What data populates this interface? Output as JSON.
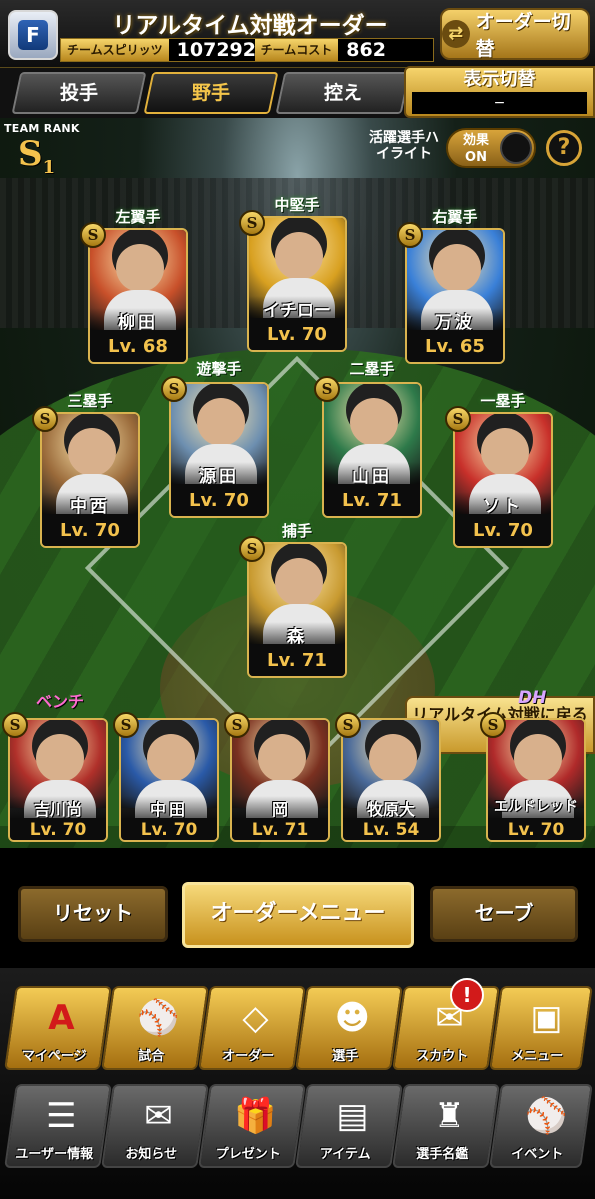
{
  "header": {
    "title": "リアルタイム対戦オーダー",
    "f_icon": "F",
    "team_spirit_label": "チームスピリッツ",
    "team_spirit_value": "107292",
    "team_cost_label": "チームコスト",
    "team_cost_value": "862",
    "order_switch_label": "オーダー切替",
    "order_switch_icon": "swap-arrows-icon"
  },
  "tabs": [
    {
      "label": "投手",
      "active": false
    },
    {
      "label": "野手",
      "active": true
    },
    {
      "label": "控え",
      "active": false
    }
  ],
  "display_switch": {
    "label": "表示切替",
    "value": "−"
  },
  "team_rank": {
    "label": "TEAM RANK",
    "value": "S",
    "sub": "1"
  },
  "highlight": {
    "label": "活躍選手ハイライト",
    "toggle_text": "効果ON",
    "help": "?"
  },
  "positions": {
    "lf": "左翼手",
    "cf": "中堅手",
    "rf": "右翼手",
    "ss": "遊撃手",
    "second": "二塁手",
    "third": "三塁手",
    "first": "一塁手",
    "catcher": "捕手",
    "bench": "ベンチ",
    "dh": "DH"
  },
  "players": {
    "lf": {
      "name": "柳田",
      "level": "Lv. 68",
      "color": "#c8502a"
    },
    "cf": {
      "name": "イチロー",
      "level": "Lv. 70",
      "color": "#d8a020"
    },
    "rf": {
      "name": "万波",
      "level": "Lv. 65",
      "color": "#3a80d8"
    },
    "third": {
      "name": "中西",
      "level": "Lv. 70",
      "color": "#9a6a3a"
    },
    "ss": {
      "name": "源田",
      "level": "Lv. 70",
      "color": "#6d8fb0"
    },
    "second": {
      "name": "山田",
      "level": "Lv. 71",
      "color": "#2e7a4a"
    },
    "first": {
      "name": "ソト",
      "level": "Lv. 70",
      "color": "#c8302a"
    },
    "catcher": {
      "name": "森",
      "level": "Lv. 71",
      "color": "#c89a30"
    }
  },
  "back_button": "リアルタイム対戦に戻る",
  "bench": [
    {
      "name": "吉川尚",
      "level": "Lv. 70",
      "color": "#b0302a"
    },
    {
      "name": "中田",
      "level": "Lv. 70",
      "color": "#2a5aa8"
    },
    {
      "name": "岡",
      "level": "Lv. 71",
      "color": "#7a3020"
    },
    {
      "name": "牧原大",
      "level": "Lv. 54",
      "color": "#4a6a9a"
    }
  ],
  "dh_player": {
    "name": "エルドレッド",
    "level": "Lv. 70",
    "color": "#b02a2a"
  },
  "badge": "S",
  "actions": {
    "reset": "リセット",
    "order_menu": "オーダーメニュー",
    "save": "セーブ"
  },
  "nav_top": [
    {
      "label": "マイページ",
      "icon": "A"
    },
    {
      "label": "試合",
      "icon": "⚾"
    },
    {
      "label": "オーダー",
      "icon": "◇"
    },
    {
      "label": "選手",
      "icon": "☻"
    },
    {
      "label": "スカウト",
      "icon": "✉"
    },
    {
      "label": "メニュー",
      "icon": "▣"
    }
  ],
  "nav_bottom": [
    {
      "label": "ユーザー情報",
      "icon": "☰"
    },
    {
      "label": "お知らせ",
      "icon": "✉"
    },
    {
      "label": "プレゼント",
      "icon": "🎁"
    },
    {
      "label": "アイテム",
      "icon": "▤"
    },
    {
      "label": "選手名鑑",
      "icon": "♜"
    },
    {
      "label": "イベント",
      "icon": "⚾"
    }
  ],
  "notification": "!"
}
